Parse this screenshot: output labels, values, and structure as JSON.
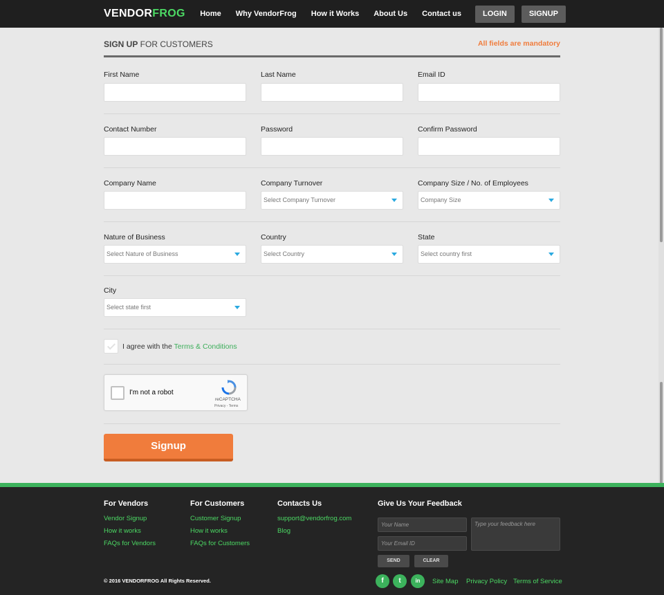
{
  "header": {
    "logo_a": "VENDOR",
    "logo_b": "FROG",
    "nav": [
      "Home",
      "Why VendorFrog",
      "How it Works",
      "About Us",
      "Contact us"
    ],
    "login": "LOGIN",
    "signup": "SIGNUP"
  },
  "form": {
    "title_bold": "SIGN UP",
    "title_rest": " FOR CUSTOMERS",
    "mandatory": "All fields are mandatory",
    "first_name": "First Name",
    "last_name": "Last Name",
    "email": "Email ID",
    "contact": "Contact Number",
    "password": "Password",
    "confirm": "Confirm Password",
    "company": "Company Name",
    "turnover": "Company Turnover",
    "turnover_ph": "Select Company Turnover",
    "size": "Company Size / No. of Employees",
    "size_ph": "Company Size",
    "nature": "Nature of Business",
    "nature_ph": "Select Nature of Business",
    "country": "Country",
    "country_ph": "Select Country",
    "state": "State",
    "state_ph": "Select country first",
    "city": "City",
    "city_ph": "Select state first",
    "agree": "I agree with the ",
    "terms": "Terms & Conditions",
    "captcha_text": "I'm not a robot",
    "captcha_brand": "reCAPTCHA",
    "captcha_links": "Privacy - Terms",
    "submit": "Signup"
  },
  "footer": {
    "vendors_head": "For Vendors",
    "vendor_links": [
      "Vendor Signup",
      "How it works",
      "FAQs for Vendors"
    ],
    "customers_head": "For Customers",
    "customer_links": [
      "Customer Signup",
      "How it works",
      "FAQs for Customers"
    ],
    "contacts_head": "Contacts Us",
    "contact_links": [
      "support@vendorfrog.com",
      "Blog"
    ],
    "feedback_head": "Give Us Your Feedback",
    "name_ph": "Your Name",
    "email_ph": "Your Email ID",
    "feedback_ph": "Type your feedback  here",
    "send": "SEND",
    "clear": "CLEAR",
    "copyright": "© 2016 VENDORFROG All Rights Reserved.",
    "social": [
      "f",
      "t",
      "in"
    ],
    "bottom_links": [
      "Site Map",
      "Privacy Policy",
      "Terms of Service"
    ]
  },
  "colors": {
    "accent_green": "#4cd964",
    "accent_orange": "#f07c3c",
    "header_bg": "#1f1f1f",
    "footer_bg": "#242424"
  }
}
